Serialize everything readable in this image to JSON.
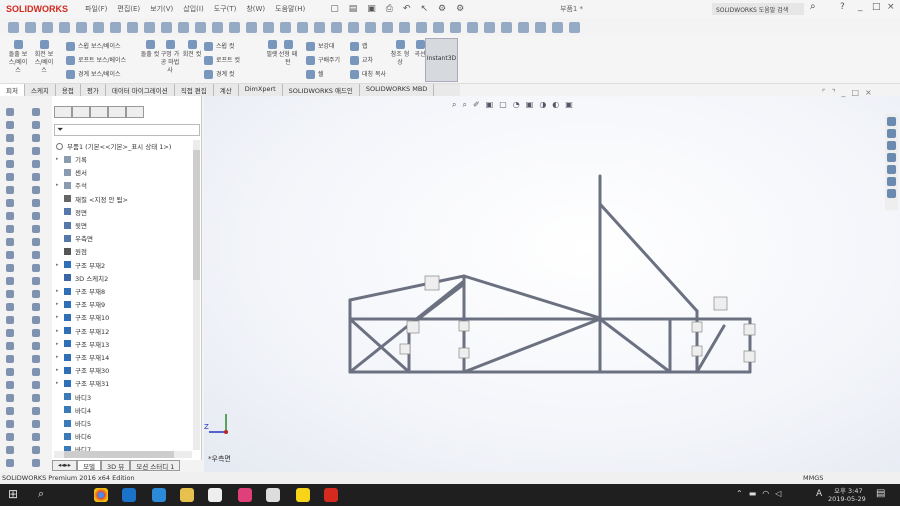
{
  "app": {
    "name": "SOLIDWORKS",
    "document_title": "부품1 *",
    "search_placeholder": "SOLIDWORKS 도움말 검색"
  },
  "menu": [
    "파일(F)",
    "편집(E)",
    "보기(V)",
    "삽입(I)",
    "도구(T)",
    "창(W)",
    "도움말(H)"
  ],
  "ribbon": {
    "items": [
      "돌출 보스/베이스",
      "회전 보스/베이스",
      "스윕 보스/베이스",
      "로프트 보스/베이스",
      "경계 보스/베이스",
      "돌출 컷",
      "구멍 가공 마법사",
      "회전 컷",
      "스윕 컷",
      "로프트 컷",
      "경계 컷",
      "필렛",
      "선형 패턴",
      "보강대",
      "구배주기",
      "쉘",
      "랩",
      "교차",
      "대칭 복사",
      "참조 형상",
      "곡선",
      "Instant3D"
    ]
  },
  "tabs": [
    {
      "label": "피처",
      "active": true
    },
    {
      "label": "스케치"
    },
    {
      "label": "용접"
    },
    {
      "label": "평가"
    },
    {
      "label": "데이터 마이그레이션"
    },
    {
      "label": "직접 편집"
    },
    {
      "label": "계산"
    },
    {
      "label": "DimXpert"
    },
    {
      "label": "SOLIDWORKS 애드인"
    },
    {
      "label": "SOLIDWORKS MBD"
    }
  ],
  "tree": {
    "root": "부품1 (기본<<기본>_표시 상태 1>)",
    "items": [
      {
        "label": "기록",
        "expand": true,
        "icon": "folder-icon"
      },
      {
        "label": "센서",
        "expand": false,
        "icon": "sensor-icon"
      },
      {
        "label": "주석",
        "expand": true,
        "icon": "annotation-icon"
      },
      {
        "label": "재질 <지정 안 됨>",
        "expand": false,
        "icon": "material-icon"
      },
      {
        "label": "정면",
        "expand": false,
        "icon": "plane-icon"
      },
      {
        "label": "윗면",
        "expand": false,
        "icon": "plane-icon"
      },
      {
        "label": "우측면",
        "expand": false,
        "icon": "plane-icon"
      },
      {
        "label": "원점",
        "expand": false,
        "icon": "origin-icon"
      },
      {
        "label": "구조 부재2",
        "expand": true,
        "icon": "structural-member-icon"
      },
      {
        "label": "3D 스케치2",
        "expand": false,
        "icon": "sketch-icon"
      },
      {
        "label": "구조 부재8",
        "expand": true,
        "icon": "structural-member-icon"
      },
      {
        "label": "구조 부재9",
        "expand": true,
        "icon": "structural-member-icon"
      },
      {
        "label": "구조 부재10",
        "expand": true,
        "icon": "structural-member-icon"
      },
      {
        "label": "구조 부재12",
        "expand": true,
        "icon": "structural-member-icon"
      },
      {
        "label": "구조 부재13",
        "expand": true,
        "icon": "structural-member-icon"
      },
      {
        "label": "구조 부재14",
        "expand": true,
        "icon": "structural-member-icon"
      },
      {
        "label": "구조 부재30",
        "expand": true,
        "icon": "structural-member-icon"
      },
      {
        "label": "구조 부재31",
        "expand": true,
        "icon": "structural-member-icon"
      },
      {
        "label": "바디3",
        "expand": false,
        "icon": "body-icon"
      },
      {
        "label": "바디4",
        "expand": false,
        "icon": "body-icon"
      },
      {
        "label": "바디5",
        "expand": false,
        "icon": "body-icon"
      },
      {
        "label": "바디6",
        "expand": false,
        "icon": "body-icon"
      },
      {
        "label": "바디7",
        "expand": false,
        "icon": "body-icon"
      }
    ]
  },
  "bottom_tabs": [
    {
      "label": "모델",
      "active": true
    },
    {
      "label": "3D 뷰"
    },
    {
      "label": "모션 스터디 1"
    }
  ],
  "viewport": {
    "view_label": "*우측면",
    "triad_axis": "Z"
  },
  "status": {
    "edition": "SOLIDWORKS Premium 2016 x64 Edition",
    "units": "MMGS"
  },
  "taskbar": {
    "time": "오후 3:47",
    "date": "2019-05-29",
    "ime": "A",
    "notifications": "2"
  },
  "colors": {
    "brand": "#d42a1f",
    "model": "#6b7180",
    "taskbar": "#1f1f1f"
  }
}
